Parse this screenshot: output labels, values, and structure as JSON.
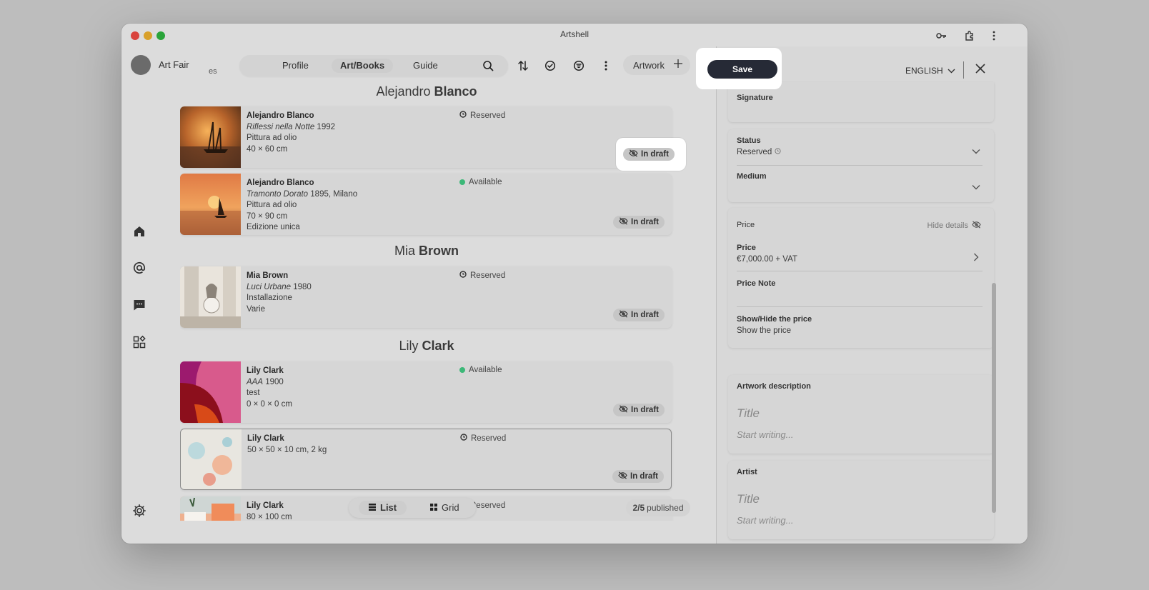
{
  "window": {
    "title": "Artshell"
  },
  "account": {
    "name": "Art Fair",
    "sub": "es"
  },
  "nav": {
    "tabs": [
      {
        "label": "Profile"
      },
      {
        "label": "Art/Books"
      },
      {
        "label": "Guide"
      }
    ],
    "artwork_label": "Artwork"
  },
  "groups": [
    {
      "first": "Alejandro",
      "last": "Blanco"
    },
    {
      "first": "Mia",
      "last": "Brown"
    },
    {
      "first": "Lily",
      "last": "Clark"
    }
  ],
  "cards": [
    {
      "name": "Alejandro Blanco",
      "title": "Riflessi nella Notte",
      "title_rest": " 1992",
      "line3": "Pittura ad olio",
      "line4": "40 × 60 cm",
      "line5": "",
      "status": "Reserved",
      "status_type": "reserved",
      "draft": "In draft"
    },
    {
      "name": "Alejandro Blanco",
      "title": "Tramonto Dorato",
      "title_rest": " 1895, Milano",
      "line3": "Pittura ad olio",
      "line4": "70 × 90 cm",
      "line5": "Edizione unica",
      "status": "Available",
      "status_type": "available",
      "draft": "In draft"
    },
    {
      "name": "Mia Brown",
      "title": "Luci Urbane",
      "title_rest": " 1980",
      "line3": "Installazione",
      "line4": "Varie",
      "line5": "",
      "status": "Reserved",
      "status_type": "reserved",
      "draft": "In draft"
    },
    {
      "name": "Lily Clark",
      "title": "AAA",
      "title_rest": " 1900",
      "line3": "test",
      "line4": "0 × 0 × 0 cm",
      "line5": "",
      "status": "Available",
      "status_type": "available",
      "draft": "In draft"
    },
    {
      "name": "Lily Clark",
      "title": "",
      "title_rest": "50 × 50 × 10 cm, 2 kg",
      "line3": "",
      "line4": "",
      "line5": "",
      "status": "Reserved",
      "status_type": "reserved",
      "draft": "In draft"
    },
    {
      "name": "Lily Clark",
      "title": "",
      "title_rest": "80 × 100 cm",
      "line3": "",
      "line4": "",
      "line5": "",
      "status": "Reserved",
      "status_type": "reserved",
      "draft": ""
    }
  ],
  "view_toggle": {
    "list": "List",
    "grid": "Grid"
  },
  "published": {
    "count": "2/5",
    "label": "published"
  },
  "editor": {
    "save_label": "Save",
    "language": "ENGLISH",
    "signature_label": "Signature",
    "status_label": "Status",
    "status_value": "Reserved",
    "medium_label": "Medium",
    "price_section": "Price",
    "hide_details": "Hide details",
    "price_label": "Price",
    "price_value": "€7,000.00 + VAT",
    "price_note_label": "Price Note",
    "show_hide_label": "Show/Hide the price",
    "show_hide_value": "Show the price",
    "description_label": "Artwork description",
    "description_title_placeholder": "Title",
    "description_body_placeholder": "Start writing...",
    "artist_label": "Artist",
    "artist_title_placeholder": "Title",
    "artist_body_placeholder": "Start writing..."
  },
  "colors": {
    "save_button": "#262a36",
    "available_dot": "#3cb878",
    "traffic_red": "#e0443e",
    "traffic_yellow": "#dea123",
    "traffic_green": "#1aab29"
  }
}
